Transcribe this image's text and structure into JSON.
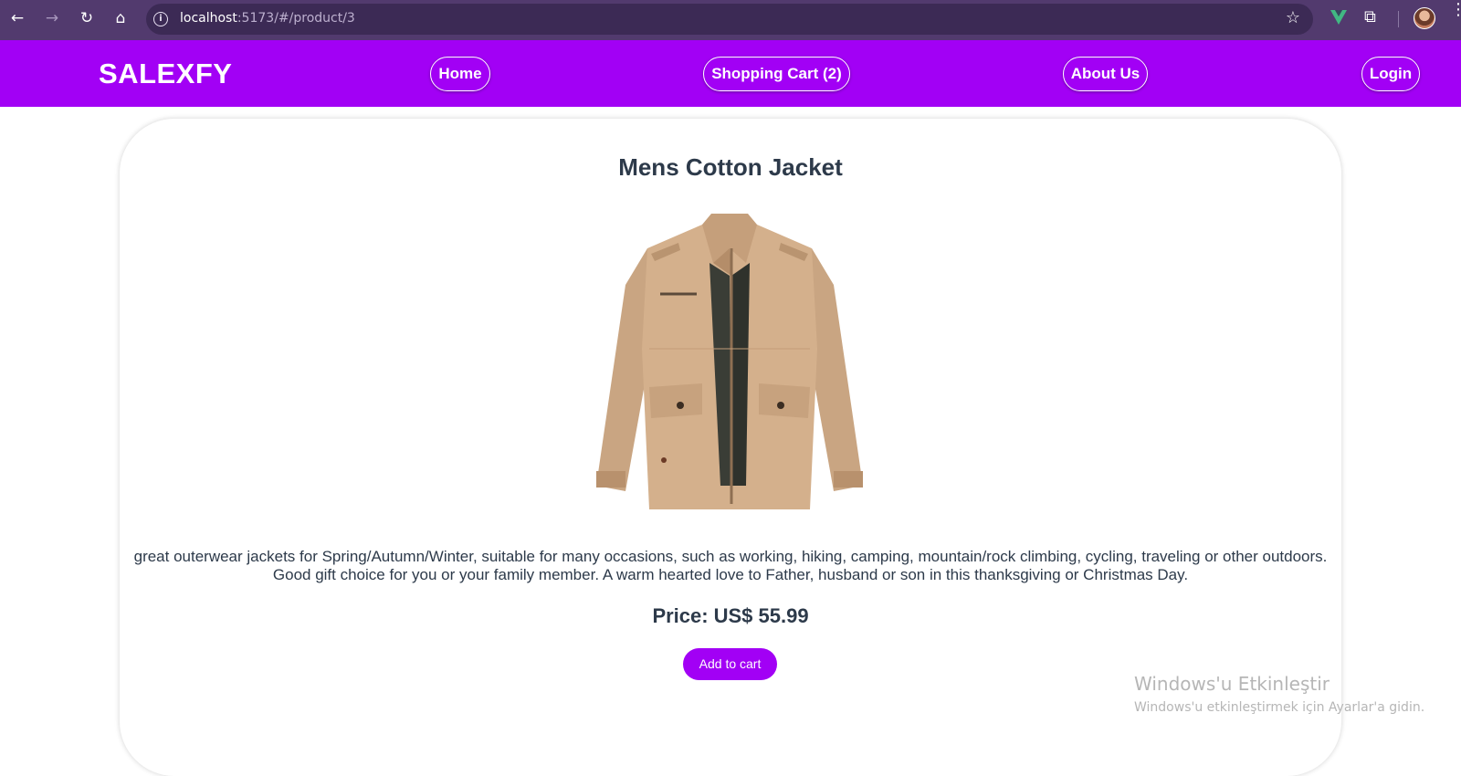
{
  "browser": {
    "url_host": "localhost",
    "url_rest": ":5173/#/product/3",
    "icons": {
      "back": "back-arrow-icon",
      "forward": "forward-arrow-icon",
      "reload": "reload-icon",
      "home": "home-icon",
      "site_info": "info-icon",
      "bookmark": "star-icon",
      "vue_devtools": "vue-icon",
      "extensions": "puzzle-icon",
      "profile": "avatar",
      "menu": "kebab-menu-icon"
    }
  },
  "header": {
    "logo": "SALEXFY",
    "nav": {
      "home": "Home",
      "cart": "Shopping Cart (2)",
      "about": "About Us",
      "login": "Login"
    }
  },
  "product": {
    "title": "Mens Cotton Jacket",
    "description_line1": "great outerwear jackets for Spring/Autumn/Winter, suitable for many occasions, such as working, hiking, camping, mountain/rock climbing, cycling, traveling or other outdoors.",
    "description_line2": "Good gift choice for you or your family member. A warm hearted love to Father, husband or son in this thanksgiving or Christmas Day.",
    "price_label": "Price:",
    "price_value": "US$ 55.99",
    "add_to_cart": "Add to cart"
  },
  "watermark": {
    "title": "Windows'u Etkinleştir",
    "subtitle": "Windows'u etkinleştirmek için Ayarlar'a gidin."
  },
  "colors": {
    "brand": "#a200f5",
    "chrome": "#523a6e",
    "text": "#2d3a4a"
  }
}
